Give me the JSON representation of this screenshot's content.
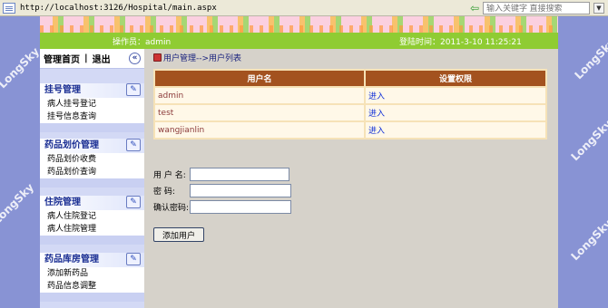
{
  "browser": {
    "url": "http://localhost:3126/Hospital/main.aspx",
    "search_placeholder": "输入关键字 直接搜索",
    "dropdown_symbol": "▼",
    "back_symbol": "⇦"
  },
  "watermark": "LongSky",
  "header": {
    "operator": "操作员：admin",
    "login_time": "登陆时间：2011-3-10 11:25:21"
  },
  "nav": {
    "home": "管理首页",
    "separator": "|",
    "logout": "退出",
    "collapse_symbol": "«",
    "groups": [
      {
        "title": "挂号管理",
        "icon": "clipboard-icon",
        "items": [
          "病人挂号登记",
          "挂号信息查询"
        ]
      },
      {
        "title": "药品划价管理",
        "icon": "edit-icon",
        "items": [
          "药品划价收费",
          "药品划价查询"
        ]
      },
      {
        "title": "住院管理",
        "icon": "edit-icon",
        "items": [
          "病人住院登记",
          "病人住院管理"
        ]
      },
      {
        "title": "药品库房管理",
        "icon": "edit-icon",
        "items": [
          "添加新药品",
          "药品信息调整"
        ]
      }
    ]
  },
  "breadcrumb": "用户管理-->用户列表",
  "table": {
    "headers": [
      "用户名",
      "设置权限"
    ],
    "rows": [
      {
        "name": "admin",
        "action": "进入"
      },
      {
        "name": "test",
        "action": "进入"
      },
      {
        "name": "wangjianlin",
        "action": "进入"
      }
    ]
  },
  "form": {
    "username_label": "用 户  名:",
    "password_label": "密    码:",
    "confirm_label": "确认密码:",
    "username_value": "",
    "password_value": "",
    "confirm_value": "",
    "submit_label": "添加用户"
  },
  "colors": {
    "header_green": "#8fcc33",
    "table_header": "#a3521f",
    "side_blue": "#8893d4"
  }
}
